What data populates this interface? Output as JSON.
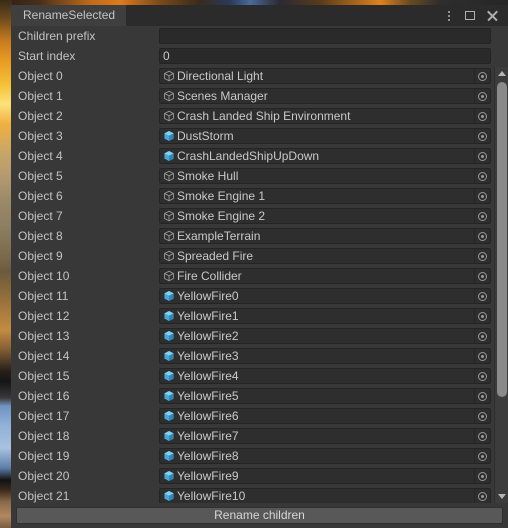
{
  "window": {
    "tab_title": "RenameSelected",
    "accent_color": "#4f7fbf",
    "controls": [
      {
        "name": "kebab-menu-icon",
        "label": "⋮"
      },
      {
        "name": "maximize-icon",
        "label": "□"
      },
      {
        "name": "close-icon",
        "label": "✕"
      }
    ]
  },
  "fields": {
    "children_prefix": {
      "label": "Children prefix",
      "value": "",
      "placeholder": ""
    },
    "start_index": {
      "label": "Start index",
      "value": "0",
      "placeholder": ""
    }
  },
  "objects": [
    {
      "label": "Object 0",
      "name": "Directional Light",
      "icon": "gameobject-cube-icon"
    },
    {
      "label": "Object 1",
      "name": "Scenes Manager",
      "icon": "gameobject-cube-icon"
    },
    {
      "label": "Object 2",
      "name": "Crash Landed Ship Environment",
      "icon": "gameobject-cube-icon"
    },
    {
      "label": "Object 3",
      "name": "DustStorm",
      "icon": "prefab-cube-icon"
    },
    {
      "label": "Object 4",
      "name": "CrashLandedShipUpDown",
      "icon": "prefab-cube-icon"
    },
    {
      "label": "Object 5",
      "name": "Smoke Hull",
      "icon": "gameobject-cube-icon"
    },
    {
      "label": "Object 6",
      "name": "Smoke Engine 1",
      "icon": "gameobject-cube-icon"
    },
    {
      "label": "Object 7",
      "name": "Smoke Engine 2",
      "icon": "gameobject-cube-icon"
    },
    {
      "label": "Object 8",
      "name": "ExampleTerrain",
      "icon": "gameobject-cube-icon"
    },
    {
      "label": "Object 9",
      "name": "Spreaded Fire",
      "icon": "gameobject-cube-icon"
    },
    {
      "label": "Object 10",
      "name": "Fire Collider",
      "icon": "gameobject-cube-icon"
    },
    {
      "label": "Object 11",
      "name": "YellowFire0",
      "icon": "prefab-cube-icon"
    },
    {
      "label": "Object 12",
      "name": "YellowFire1",
      "icon": "prefab-cube-icon"
    },
    {
      "label": "Object 13",
      "name": "YellowFire2",
      "icon": "prefab-cube-icon"
    },
    {
      "label": "Object 14",
      "name": "YellowFire3",
      "icon": "prefab-cube-icon"
    },
    {
      "label": "Object 15",
      "name": "YellowFire4",
      "icon": "prefab-cube-icon"
    },
    {
      "label": "Object 16",
      "name": "YellowFire5",
      "icon": "prefab-cube-icon"
    },
    {
      "label": "Object 17",
      "name": "YellowFire6",
      "icon": "prefab-cube-icon"
    },
    {
      "label": "Object 18",
      "name": "YellowFire7",
      "icon": "prefab-cube-icon"
    },
    {
      "label": "Object 19",
      "name": "YellowFire8",
      "icon": "prefab-cube-icon"
    },
    {
      "label": "Object 20",
      "name": "YellowFire9",
      "icon": "prefab-cube-icon"
    },
    {
      "label": "Object 21",
      "name": "YellowFire10",
      "icon": "prefab-cube-icon"
    }
  ],
  "scrollbar": {
    "up_arrow": "▲",
    "down_arrow": "▼"
  },
  "footer": {
    "rename_label": "Rename children"
  },
  "colors": {
    "panel_bg": "#383838",
    "field_bg": "#2e2e2e",
    "text": "#c2c2c2",
    "prefab_blue": "#49a8d8",
    "button_bg": "#585858"
  }
}
